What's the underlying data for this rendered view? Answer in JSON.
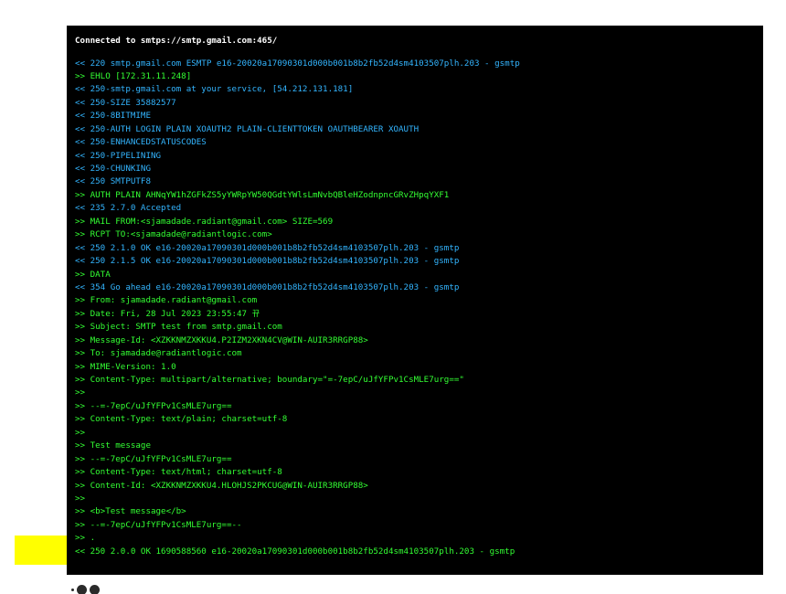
{
  "terminal": {
    "header": "Connected to smtps://smtp.gmail.com:465/",
    "lines": [
      {
        "dir": "in",
        "text": "<< 220 smtp.gmail.com ESMTP e16-20020a17090301d000b001b8b2fb52d4sm4103507plh.203 - gsmtp"
      },
      {
        "dir": "out",
        "text": ">> EHLO [172.31.11.248]"
      },
      {
        "dir": "in",
        "text": "<< 250-smtp.gmail.com at your service, [54.212.131.181]"
      },
      {
        "dir": "in",
        "text": "<< 250-SIZE 35882577"
      },
      {
        "dir": "in",
        "text": "<< 250-8BITMIME"
      },
      {
        "dir": "in",
        "text": "<< 250-AUTH LOGIN PLAIN XOAUTH2 PLAIN-CLIENTTOKEN OAUTHBEARER XOAUTH"
      },
      {
        "dir": "in",
        "text": "<< 250-ENHANCEDSTATUSCODES"
      },
      {
        "dir": "in",
        "text": "<< 250-PIPELINING"
      },
      {
        "dir": "in",
        "text": "<< 250-CHUNKING"
      },
      {
        "dir": "in",
        "text": "<< 250 SMTPUTF8"
      },
      {
        "dir": "out",
        "text": ">> AUTH PLAIN AHNqYW1hZGFkZS5yYWRpYW50QGdtYWlsLmNvbQBleHZodnpncGRvZHpqYXF1"
      },
      {
        "dir": "in",
        "text": "<< 235 2.7.0 Accepted"
      },
      {
        "dir": "out",
        "text": ">> MAIL FROM:<sjamadade.radiant@gmail.com> SIZE=569"
      },
      {
        "dir": "out",
        "text": ">> RCPT TO:<sjamadade@radiantlogic.com>"
      },
      {
        "dir": "in",
        "text": "<< 250 2.1.0 OK e16-20020a17090301d000b001b8b2fb52d4sm4103507plh.203 - gsmtp"
      },
      {
        "dir": "in",
        "text": "<< 250 2.1.5 OK e16-20020a17090301d000b001b8b2fb52d4sm4103507plh.203 - gsmtp"
      },
      {
        "dir": "out",
        "text": ">> DATA"
      },
      {
        "dir": "in",
        "text": "<< 354 Go ahead e16-20020a17090301d000b001b8b2fb52d4sm4103507plh.203 - gsmtp"
      },
      {
        "dir": "out",
        "text": ">> From: sjamadade.radiant@gmail.com"
      },
      {
        "dir": "out",
        "text": ">> Date: Fri, 28 Jul 2023 23:55:47 뀨"
      },
      {
        "dir": "out",
        "text": ">> Subject: SMTP test from smtp.gmail.com"
      },
      {
        "dir": "out",
        "text": ">> Message-Id: <XZKKNMZXKKU4.P2IZM2XKN4CV@WIN-AUIR3RRGP88>"
      },
      {
        "dir": "out",
        "text": ">> To: sjamadade@radiantlogic.com"
      },
      {
        "dir": "out",
        "text": ">> MIME-Version: 1.0"
      },
      {
        "dir": "out",
        "text": ">> Content-Type: multipart/alternative; boundary=\"=-7epC/uJfYFPv1CsMLE7urg==\""
      },
      {
        "dir": "out",
        "text": ">>"
      },
      {
        "dir": "out",
        "text": ">> --=-7epC/uJfYFPv1CsMLE7urg=="
      },
      {
        "dir": "out",
        "text": ">> Content-Type: text/plain; charset=utf-8"
      },
      {
        "dir": "out",
        "text": ">>"
      },
      {
        "dir": "out",
        "text": ">> Test message"
      },
      {
        "dir": "out",
        "text": ">> --=-7epC/uJfYFPv1CsMLE7urg=="
      },
      {
        "dir": "out",
        "text": ">> Content-Type: text/html; charset=utf-8"
      },
      {
        "dir": "out",
        "text": ">> Content-Id: <XZKKNMZXKKU4.HLOHJS2PKCUG@WIN-AUIR3RRGP88>"
      },
      {
        "dir": "out",
        "text": ">>"
      },
      {
        "dir": "out",
        "text": ">> <b>Test message</b>"
      },
      {
        "dir": "out",
        "text": ">> --=-7epC/uJfYFPv1CsMLE7urg==--"
      },
      {
        "dir": "out",
        "text": ">> ."
      },
      {
        "dir": "out",
        "text": "<< 250 2.0.0 OK 1690588560 e16-20020a17090301d000b001b8b2fb52d4sm4103507plh.203 - gsmtp"
      }
    ]
  },
  "colors": {
    "terminal_bg": "#000000",
    "header_text": "#ffffff",
    "incoming_text": "#33b5ff",
    "outgoing_text": "#33ff33",
    "highlight": "#ffff00"
  },
  "pagination": {
    "icon": "dots-indicator-icon"
  }
}
